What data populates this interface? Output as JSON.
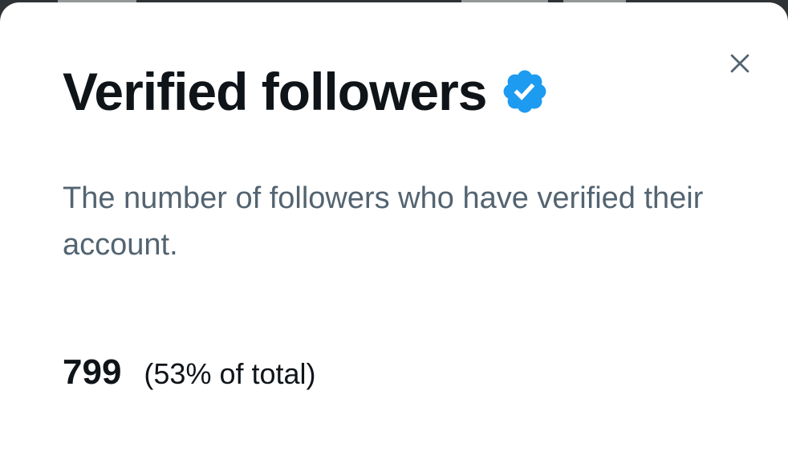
{
  "dialog": {
    "title": "Verified followers",
    "description": "The number of followers who have verified their account.",
    "stat_value": "799",
    "stat_percent": "(53% of total)",
    "close_icon": "close-icon",
    "badge_icon": "verified-badge-icon"
  },
  "colors": {
    "background": "#ffffff",
    "title": "#0f1419",
    "description": "#536471",
    "badge": "#1d9bf0",
    "close_icon": "#536471"
  }
}
